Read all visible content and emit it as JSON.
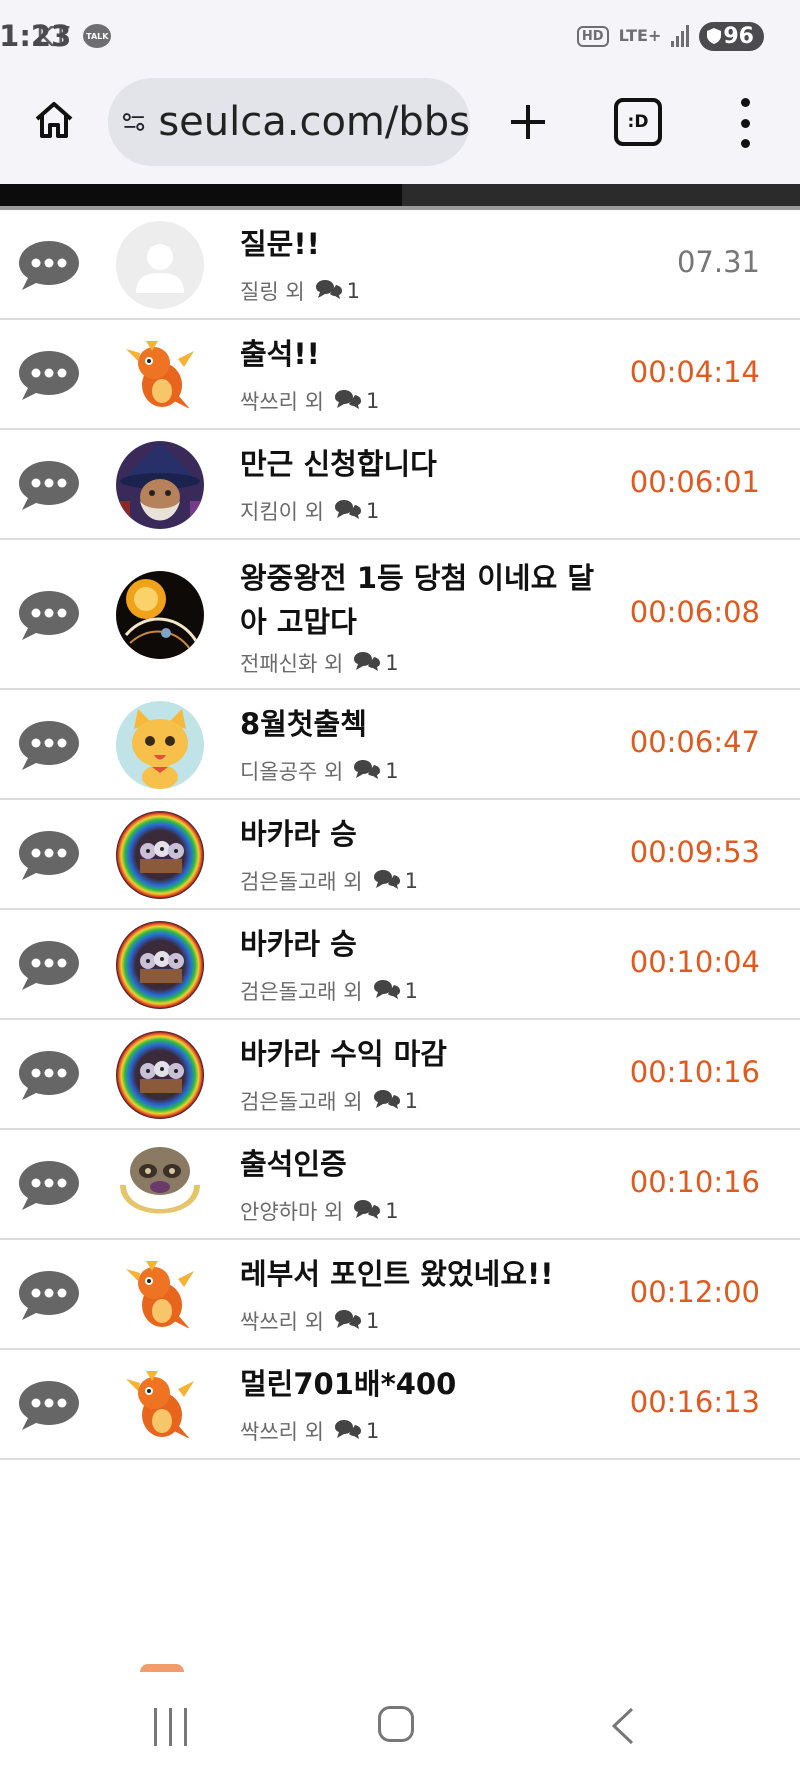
{
  "status_bar": {
    "carrier": "KT",
    "time": "1:23",
    "talk_badge": "TALK",
    "hd_badge": "HD",
    "network": "LTE+",
    "battery": "96"
  },
  "browser": {
    "url": "seulca.com/bbs",
    "tabs_label": ":D"
  },
  "colors": {
    "accent_time": "#e05a1f",
    "old_time": "#777777",
    "chat_icon": "#666666"
  },
  "posts": [
    {
      "title": "질문!!",
      "author": "질링 외",
      "comments": "1",
      "time": "07.31",
      "time_style": "gray",
      "avatar": "default"
    },
    {
      "title": "출석!!",
      "author": "싹쓰리 외",
      "comments": "1",
      "time": "00:04:14",
      "time_style": "accent",
      "avatar": "dragon"
    },
    {
      "title": "만근 신청합니다",
      "author": "지킴이 외",
      "comments": "1",
      "time": "00:06:01",
      "time_style": "accent",
      "avatar": "wizard"
    },
    {
      "title": "왕중왕전 1등 당첨 이네요 달아 고맙다",
      "author": "전패신화 외",
      "comments": "1",
      "time": "00:06:08",
      "time_style": "accent",
      "avatar": "orb"
    },
    {
      "title": "8월첫출첵",
      "author": "디올공주 외",
      "comments": "1",
      "time": "00:06:47",
      "time_style": "accent",
      "avatar": "cat"
    },
    {
      "title": "바카라 승",
      "author": "검은돌고래 외",
      "comments": "1",
      "time": "00:09:53",
      "time_style": "accent",
      "avatar": "rainbow"
    },
    {
      "title": "바카라 승",
      "author": "검은돌고래 외",
      "comments": "1",
      "time": "00:10:04",
      "time_style": "accent",
      "avatar": "rainbow"
    },
    {
      "title": "바카라 수익 마감",
      "author": "검은돌고래 외",
      "comments": "1",
      "time": "00:10:16",
      "time_style": "accent",
      "avatar": "rainbow"
    },
    {
      "title": "출석인증",
      "author": "안양하마 외",
      "comments": "1",
      "time": "00:10:16",
      "time_style": "accent",
      "avatar": "raccoon"
    },
    {
      "title": "레부서 포인트 왔었네요!!",
      "author": "싹쓰리 외",
      "comments": "1",
      "time": "00:12:00",
      "time_style": "accent",
      "avatar": "dragon"
    },
    {
      "title": "멀린701배*400",
      "author": "싹쓰리 외",
      "comments": "1",
      "time": "00:16:13",
      "time_style": "accent",
      "avatar": "dragon"
    }
  ]
}
